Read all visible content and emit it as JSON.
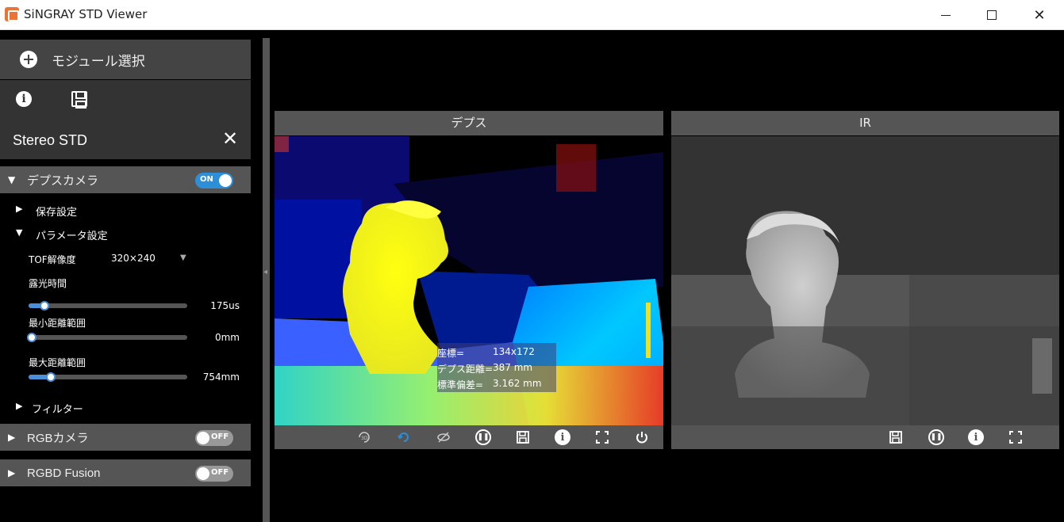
{
  "window": {
    "title": "SiNGRAY STD Viewer"
  },
  "sidebar": {
    "module_select_label": "モジュール選択",
    "device_name": "Stereo STD",
    "depth_camera": {
      "label": "デプスカメラ",
      "toggle": "ON"
    },
    "save_settings": "保存設定",
    "param_settings": "パラメータ設定",
    "tof_resolution": {
      "label": "TOF解像度",
      "value": "320×240"
    },
    "exposure": {
      "label": "露光時間",
      "value": "175us",
      "level": 0.08
    },
    "min_range": {
      "label": "最小距離範囲",
      "value": "0mm",
      "level": 0.0
    },
    "max_range": {
      "label": "最大距離範囲",
      "value": "754mm",
      "level": 0.12
    },
    "filter": "フィルター",
    "rgb_camera": {
      "label": "RGBカメラ",
      "toggle": "OFF"
    },
    "rgbd_fusion": {
      "label": "RGBD Fusion",
      "toggle": "OFF"
    }
  },
  "depth_panel": {
    "title": "デプス",
    "readout": {
      "coord_label": "座標=",
      "coord_value": "134x172",
      "dist_label": "デプス距離=",
      "dist_value": "387 mm",
      "std_label": "標準偏差=",
      "std_value": "3.162 mm"
    }
  },
  "ir_panel": {
    "title": "IR"
  },
  "icons": [
    "3d-view-icon",
    "rotate-icon",
    "hide-icon",
    "pause-icon",
    "save-icon",
    "info-icon",
    "fullscreen-icon",
    "power-icon"
  ],
  "colors": {
    "accent": "#2d8fd8",
    "panel_header": "#555555"
  }
}
